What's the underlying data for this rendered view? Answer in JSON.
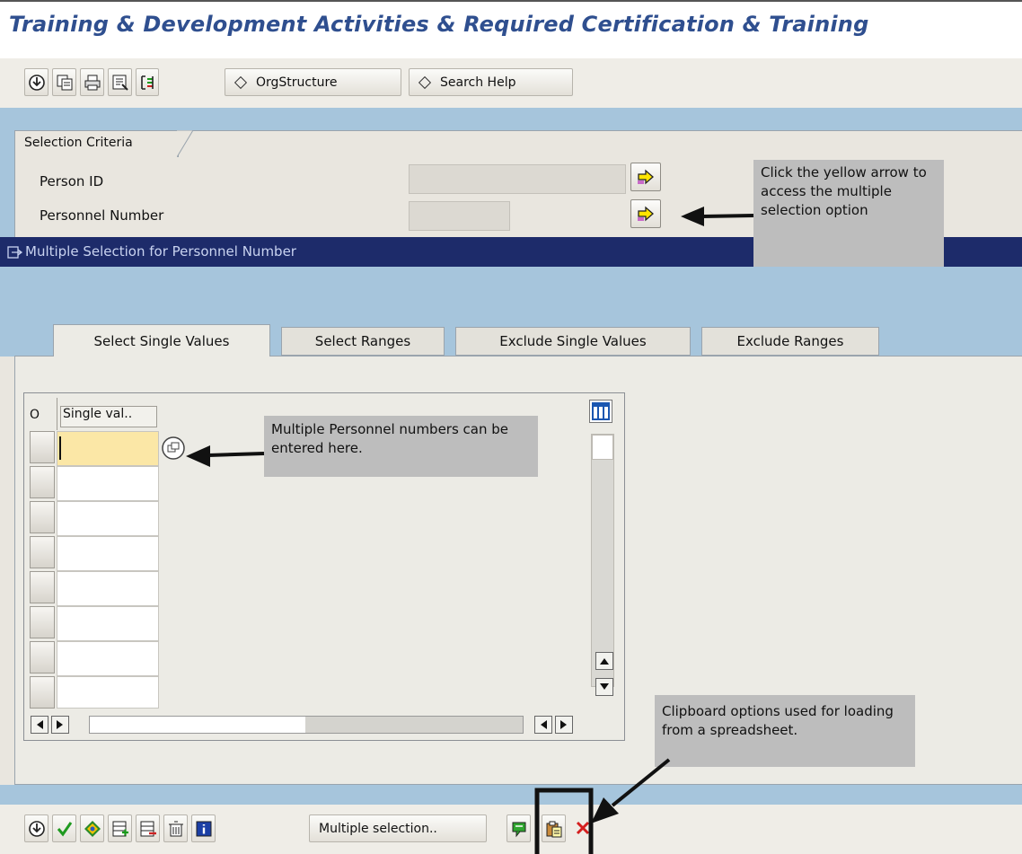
{
  "title": "Training & Development Activities & Required Certification & Training",
  "toolbar": {
    "icons": [
      "execute-icon",
      "copy-variant-icon",
      "print-icon",
      "save-variant-icon",
      "selection-options-icon"
    ],
    "org_structure_label": "OrgStructure",
    "search_help_label": "Search Help"
  },
  "selection": {
    "tab_label": "Selection Criteria",
    "person_id_label": "Person ID",
    "personnel_number_label": "Personnel Number",
    "person_id_value": "",
    "personnel_number_value": ""
  },
  "dialog": {
    "title": "Multiple Selection for Personnel Number",
    "tabs": [
      "Select Single Values",
      "Select Ranges",
      "Exclude Single Values",
      "Exclude Ranges"
    ],
    "active_tab": "Select Single Values",
    "grid": {
      "col_option": "O",
      "col_single_value": "Single val..",
      "rows": [
        "",
        "",
        "",
        "",
        "",
        "",
        "",
        ""
      ]
    },
    "bottom": {
      "multiple_selection_label": "Multiple selection.."
    }
  },
  "callouts": {
    "yellow_arrow": "Click the yellow arrow to access the multiple selection option",
    "personnel_numbers": "Multiple Personnel numbers can be entered here.",
    "clipboard": "Clipboard options used for loading from a spreadsheet."
  },
  "colors": {
    "title": "#2f4f8f",
    "navy_bar": "#1d2b6a",
    "sap_blue_bg": "#a6c5dc",
    "active_cell": "#fbe7a6",
    "callout_bg": "#bdbdbd"
  }
}
